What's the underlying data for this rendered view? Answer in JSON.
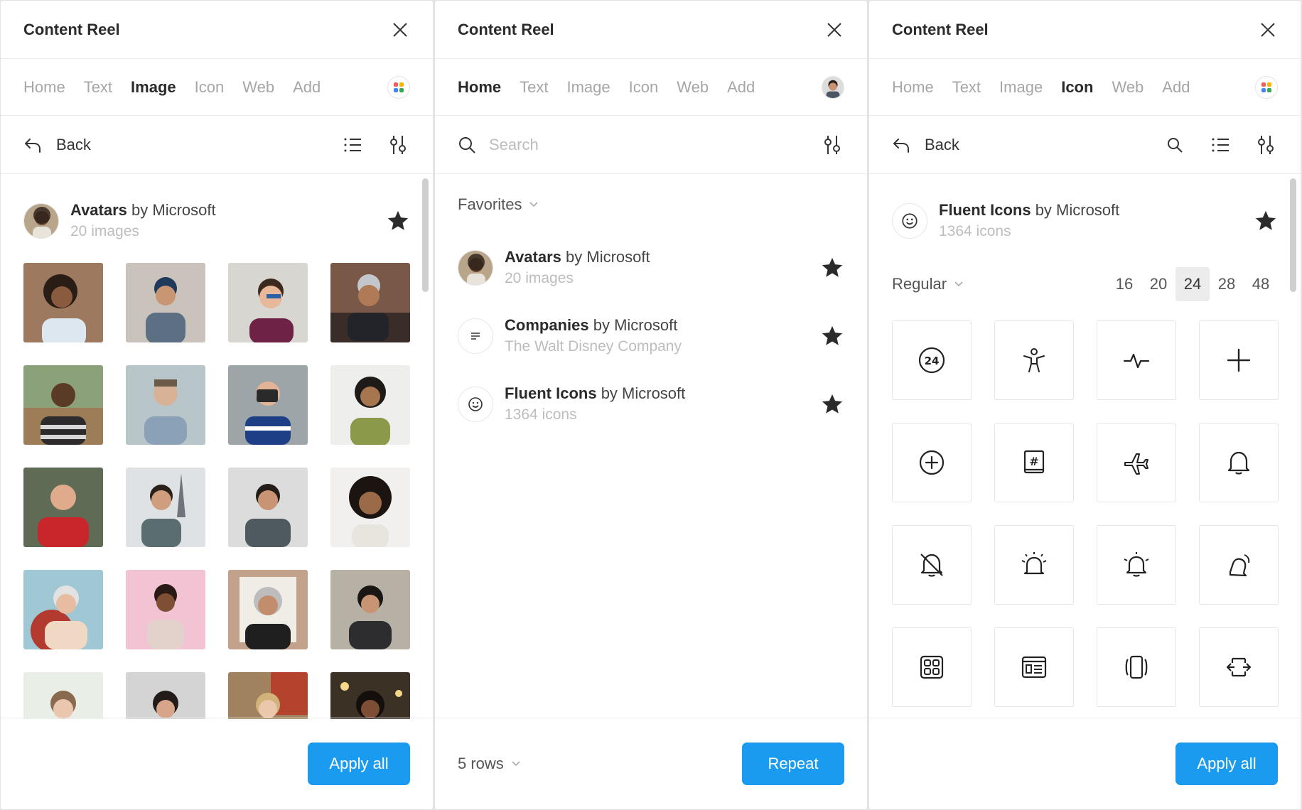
{
  "panels": [
    {
      "title": "Content Reel",
      "tabs": [
        "Home",
        "Text",
        "Image",
        "Icon",
        "Web",
        "Add"
      ],
      "active_tab": "Image",
      "back_label": "Back",
      "collection": {
        "name": "Avatars",
        "by": "by Microsoft",
        "sub": "20 images"
      },
      "button": "Apply all"
    },
    {
      "title": "Content Reel",
      "tabs": [
        "Home",
        "Text",
        "Image",
        "Icon",
        "Web",
        "Add"
      ],
      "active_tab": "Home",
      "search_placeholder": "Search",
      "favorites_label": "Favorites",
      "favorites": [
        {
          "name": "Avatars",
          "by": "by Microsoft",
          "sub": "20 images"
        },
        {
          "name": "Companies",
          "by": "by Microsoft",
          "sub": "The Walt Disney Company"
        },
        {
          "name": "Fluent Icons",
          "by": "by Microsoft",
          "sub": "1364 icons"
        }
      ],
      "rows_label": "5 rows",
      "button": "Repeat"
    },
    {
      "title": "Content Reel",
      "tabs": [
        "Home",
        "Text",
        "Image",
        "Icon",
        "Web",
        "Add"
      ],
      "active_tab": "Icon",
      "back_label": "Back",
      "collection": {
        "name": "Fluent Icons",
        "by": "by Microsoft",
        "sub": "1364 icons"
      },
      "style_label": "Regular",
      "sizes": [
        "16",
        "20",
        "24",
        "28",
        "48"
      ],
      "active_size": "24",
      "icons": [
        "24-hour-icon",
        "accessibility-icon",
        "activity-icon",
        "add-icon",
        "add-circle-icon",
        "album-hashtag-icon",
        "airplane-icon",
        "alert-icon",
        "alert-off-icon",
        "alert-urgent-icon",
        "alarm-bell-icon",
        "alert-snooze-icon",
        "app-grid-icon",
        "app-window-icon",
        "arrow-autofit-width-icon",
        "arrow-collapse-icon"
      ],
      "button": "Apply all"
    }
  ],
  "colors": {
    "accent": "#1a9bf0",
    "muted": "#a6a6a6",
    "border": "#ececec"
  }
}
